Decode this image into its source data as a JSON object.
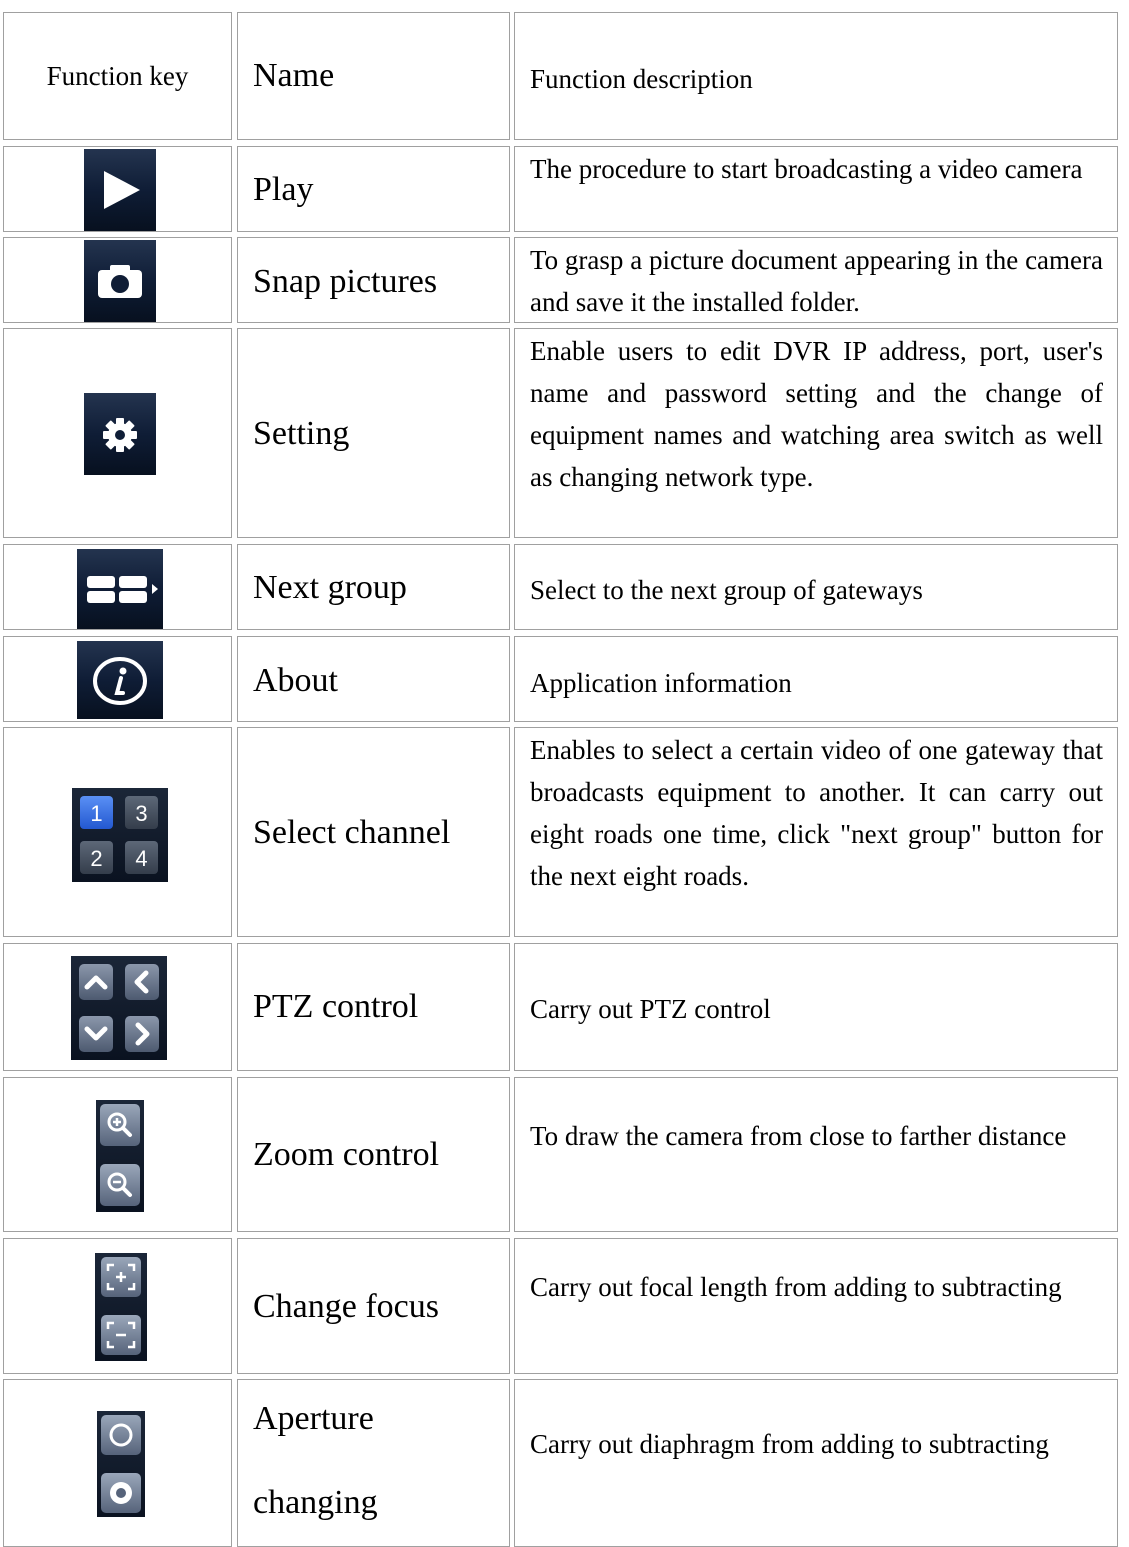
{
  "header": {
    "col_function_key": "Function key",
    "col_name": "Name",
    "col_description": "Function description"
  },
  "rows": [
    {
      "icon": "play-icon",
      "name": "Play",
      "description": "The procedure to start broadcasting a video camera"
    },
    {
      "icon": "camera-icon",
      "name": "Snap pictures",
      "description": "To grasp a picture document appearing in the camera and save it the installed folder."
    },
    {
      "icon": "gear-icon",
      "name": "Setting",
      "description": "Enable users to edit DVR IP address, port, user's name and password setting and the change of equipment names and watching area switch as well as changing network type."
    },
    {
      "icon": "next-group-icon",
      "name": "Next group",
      "description": "Select to the next group of gateways"
    },
    {
      "icon": "info-icon",
      "name": "About",
      "description": "Application information"
    },
    {
      "icon": "channel-grid-icon",
      "name": "Select channel",
      "description": "Enables to select a certain video of one gateway that broadcasts equipment to another. It can carry out eight roads one time, click \"next group\" button for the next eight roads.",
      "channel_digits": [
        "1",
        "3",
        "2",
        "4"
      ]
    },
    {
      "icon": "ptz-arrows-icon",
      "name": "PTZ control",
      "description": "Carry out PTZ control"
    },
    {
      "icon": "zoom-icon",
      "name": "Zoom control",
      "description": "To draw the camera from close to farther distance"
    },
    {
      "icon": "focus-icon",
      "name": "Change focus",
      "description": "Carry out focal length from adding to subtracting"
    },
    {
      "icon": "aperture-icon",
      "name_line1": "Aperture",
      "name_line2": "changing",
      "description": "Carry out diaphragm from adding to subtracting"
    }
  ],
  "colors": {
    "icon_bg": "#0e1c33",
    "border": "#a0a0a0",
    "channel_active": "#2f6de0"
  }
}
